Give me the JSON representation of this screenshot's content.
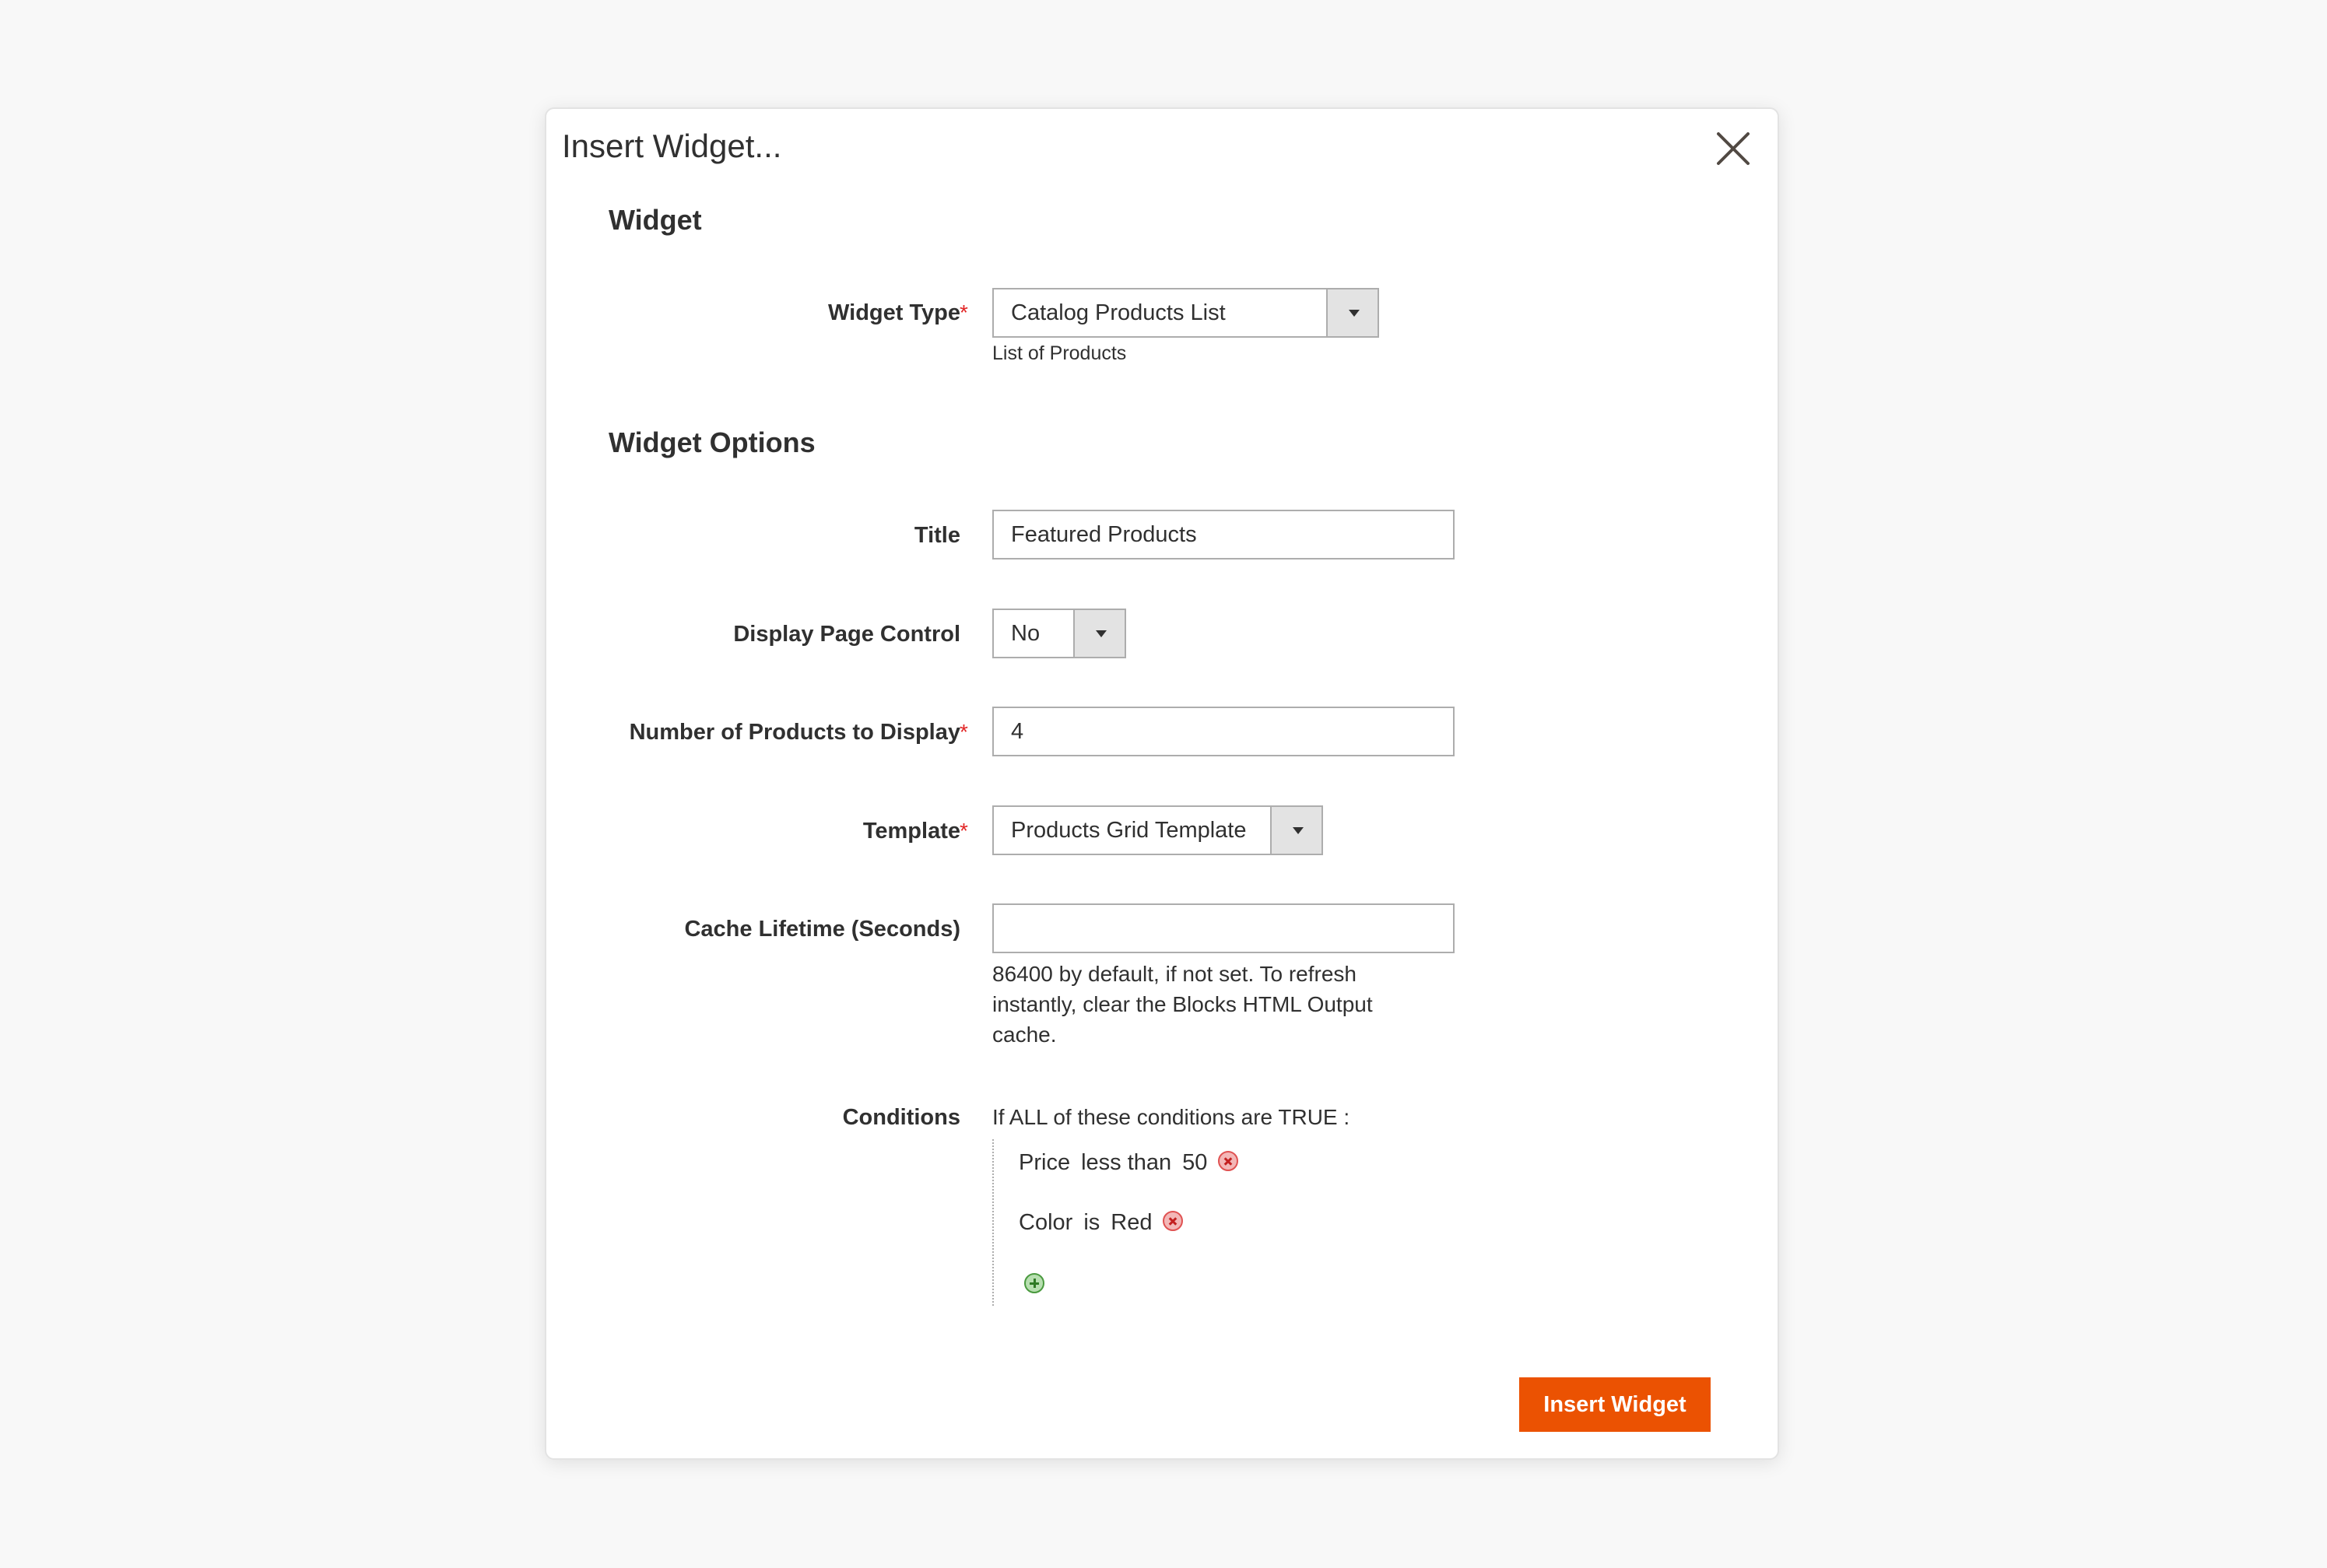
{
  "dialog": {
    "title": "Insert Widget...",
    "close_icon": "close-icon"
  },
  "widget_section": {
    "heading": "Widget",
    "widget_type": {
      "label": "Widget Type",
      "required_mark": "*",
      "value": "Catalog Products List",
      "note": "List of Products"
    }
  },
  "options_section": {
    "heading": "Widget Options",
    "title": {
      "label": "Title",
      "value": "Featured Products"
    },
    "display_page_control": {
      "label": "Display Page Control",
      "value": "No"
    },
    "num_products": {
      "label": "Number of Products to Display",
      "required_mark": "*",
      "value": "4"
    },
    "template": {
      "label": "Template",
      "required_mark": "*",
      "value": "Products Grid Template"
    },
    "cache_lifetime": {
      "label": "Cache Lifetime (Seconds)",
      "value": "",
      "note": "86400 by default, if not set. To refresh instantly, clear the Blocks HTML Output cache."
    },
    "conditions": {
      "label": "Conditions",
      "header": "If ALL  of these conditions are TRUE :",
      "rules": [
        {
          "attribute": "Price",
          "operator": "less than",
          "value": "50"
        },
        {
          "attribute": "Color",
          "operator": "is",
          "value": "Red"
        }
      ],
      "add_icon": "add-condition-icon",
      "remove_icon": "remove-condition-icon"
    }
  },
  "footer": {
    "insert_button_label": "Insert Widget"
  },
  "colors": {
    "accent": "#eb5202",
    "required": "#e22626",
    "text": "#303030",
    "background": "#f8f8f8"
  }
}
